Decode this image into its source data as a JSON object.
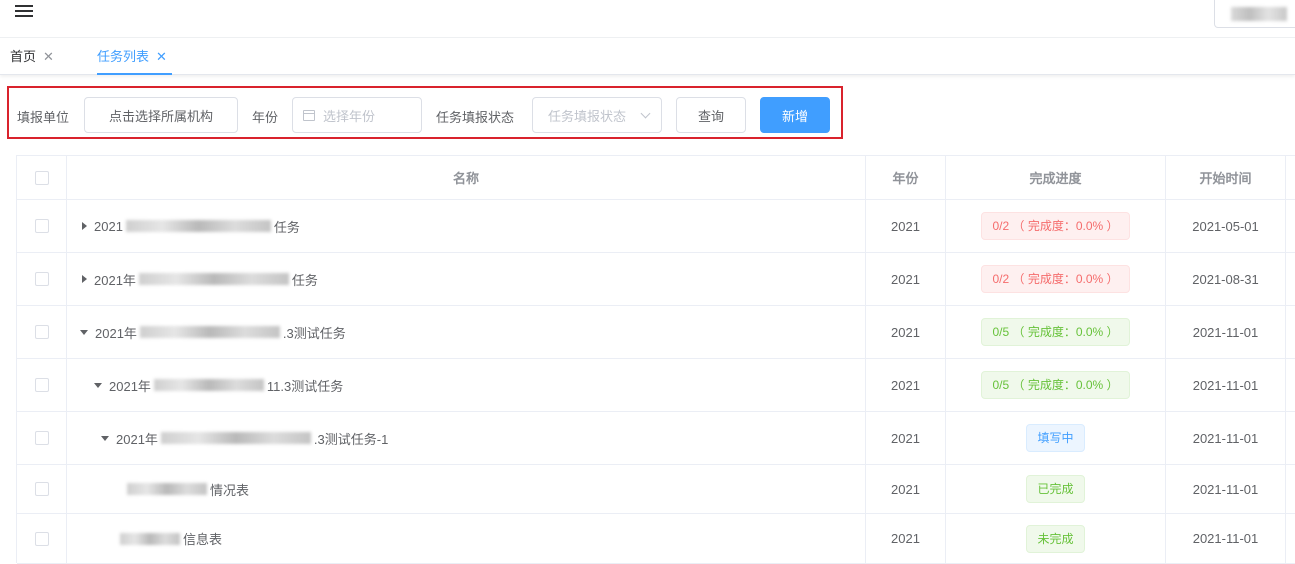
{
  "tabs": [
    {
      "label": "首页"
    },
    {
      "label": "任务列表"
    }
  ],
  "filter": {
    "unit_label": "填报单位",
    "unit_button": "点击选择所属机构",
    "year_label": "年份",
    "year_placeholder": "选择年份",
    "status_label": "任务填报状态",
    "status_placeholder": "任务填报状态",
    "query_button": "查询",
    "add_button": "新增"
  },
  "table": {
    "headers": {
      "name": "名称",
      "year": "年份",
      "progress": "完成进度",
      "start": "开始时间"
    },
    "rows": [
      {
        "prefix": "2021",
        "suffix": "任务",
        "year": "2021",
        "progress": "0/2 （ 完成度：0.0% ）",
        "status_type": "danger",
        "start": "2021-05-01",
        "expand": "collapsed"
      },
      {
        "prefix": "2021年",
        "suffix": "任务",
        "year": "2021",
        "progress": "0/2 （ 完成度：0.0% ）",
        "status_type": "danger",
        "start": "2021-08-31",
        "expand": "collapsed"
      },
      {
        "prefix": "2021年",
        "suffix": ".3测试任务",
        "year": "2021",
        "progress": "0/5 （ 完成度：0.0% ）",
        "status_type": "success",
        "start": "2021-11-01",
        "expand": "expanded"
      },
      {
        "prefix": "2021年",
        "suffix": "11.3测试任务",
        "year": "2021",
        "progress": "0/5 （ 完成度：0.0% ）",
        "status_type": "success",
        "start": "2021-11-01",
        "expand": "expanded"
      },
      {
        "prefix": "2021年",
        "suffix": ".3测试任务-1",
        "year": "2021",
        "progress": "填写中",
        "status_type": "info",
        "start": "2021-11-01",
        "expand": "expanded"
      },
      {
        "prefix": "",
        "suffix": "情况表",
        "year": "2021",
        "progress": "已完成",
        "status_type": "success",
        "start": "2021-11-01",
        "expand": "none"
      },
      {
        "prefix": "",
        "suffix": "信息表",
        "year": "2021",
        "progress": "未完成",
        "status_type": "success",
        "start": "2021-11-01",
        "expand": "none"
      }
    ]
  },
  "colors": {
    "primary": "#409eff",
    "danger": "#f56c6c",
    "success": "#67c23a",
    "highlight_border": "#d9232d"
  },
  "icons": [
    "menu-icon",
    "close-icon",
    "calendar-icon",
    "chevron-down-icon",
    "caret-right-icon",
    "caret-down-icon"
  ]
}
